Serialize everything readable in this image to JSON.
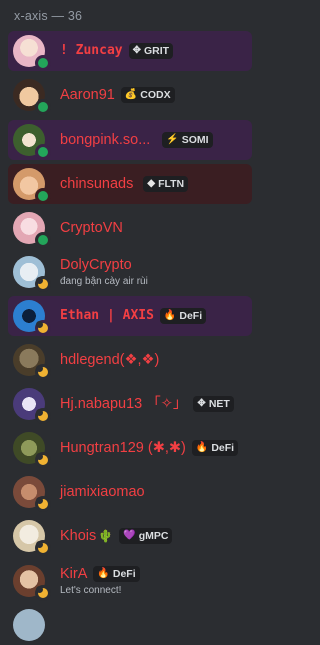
{
  "section_header": "x-axis — 36",
  "members": [
    {
      "name": "! Zuncay",
      "tag": "GRIT",
      "tag_icon": "crosshair-icon",
      "status": "online",
      "highlight": "purple",
      "avatar_color": "#e9b7c6",
      "style": "pixel"
    },
    {
      "name": "Aaron91",
      "tag": "CODX",
      "tag_icon": "money-bag-icon",
      "status": "online",
      "highlight": "",
      "avatar_color": "#c98b5e"
    },
    {
      "name": "bongpink.so...",
      "tag": "SOMI",
      "tag_icon": "lightning-icon",
      "status": "online",
      "highlight": "purple",
      "avatar_color": "#3d5f2e"
    },
    {
      "name": "chinsunads",
      "tag": "FLTN",
      "tag_icon": "gem-icon",
      "status": "online",
      "highlight": "red",
      "avatar_color": "#d49a6a"
    },
    {
      "name": "CryptoVN",
      "tag": "",
      "status": "online",
      "highlight": "",
      "avatar_color": "#e3a7b4"
    },
    {
      "name": "DolyCrypto",
      "activity": "đang bận cày air rùi",
      "tag": "",
      "status": "idle",
      "highlight": "",
      "avatar_color": "#9fbfd6"
    },
    {
      "name": "Ethan | AXIS",
      "tag": "DeFi",
      "tag_icon": "flame-icon",
      "status": "idle",
      "highlight": "purple",
      "avatar_color": "#2c7fd0",
      "style": "pixel"
    },
    {
      "name": "hdlegend(❖,❖)",
      "tag": "",
      "status": "idle",
      "highlight": "",
      "avatar_color": "#6b5a3e"
    },
    {
      "name": "Hj.nabapu13 「✧」",
      "tag": "NET",
      "tag_icon": "crosshair-icon",
      "status": "idle",
      "highlight": "",
      "avatar_color": "#4a3b7a"
    },
    {
      "name": "Hungtran129 (✱,✱)",
      "tag": "DeFi",
      "tag_icon": "flame-icon",
      "status": "idle",
      "highlight": "",
      "avatar_color": "#5d6b3a"
    },
    {
      "name": "jiamixiaomao",
      "tag": "",
      "status": "idle",
      "highlight": "",
      "avatar_color": "#7a4a3a"
    },
    {
      "name": "Khois",
      "name_suffix_icon": "cactus-icon",
      "tag": "gMPC",
      "tag_icon": "heart-icon",
      "status": "idle",
      "highlight": "",
      "avatar_color": "#d6c7a8"
    },
    {
      "name": "KirA",
      "activity": "Let's connect!",
      "tag": "DeFi",
      "tag_icon": "flame-icon",
      "status": "idle",
      "highlight": "",
      "avatar_color": "#b07a5a"
    }
  ]
}
